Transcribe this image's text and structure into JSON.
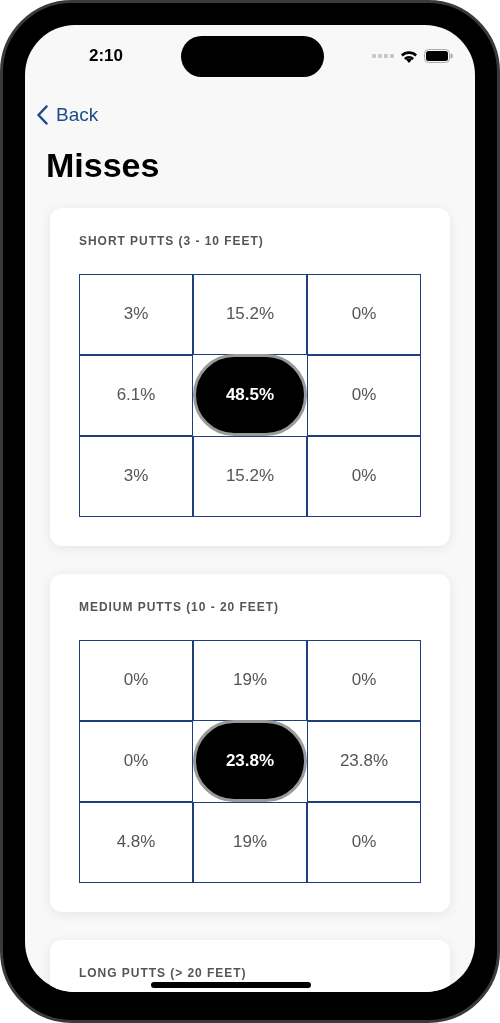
{
  "status_bar": {
    "time": "2:10"
  },
  "back_button": {
    "label": "Back"
  },
  "title": "Misses",
  "sections": [
    {
      "title": "SHORT PUTTS (3 - 10 FEET)",
      "cells": [
        {
          "kind": "zone",
          "value": "3%"
        },
        {
          "kind": "zone",
          "value": "15.2%"
        },
        {
          "kind": "zone",
          "value": "0%"
        },
        {
          "kind": "zone",
          "value": "6.1%"
        },
        {
          "kind": "target",
          "value": "48.5%"
        },
        {
          "kind": "zone",
          "value": "0%"
        },
        {
          "kind": "zone",
          "value": "3%"
        },
        {
          "kind": "zone",
          "value": "15.2%"
        },
        {
          "kind": "zone",
          "value": "0%"
        }
      ]
    },
    {
      "title": "MEDIUM PUTTS (10 - 20 FEET)",
      "cells": [
        {
          "kind": "zone",
          "value": "0%"
        },
        {
          "kind": "zone",
          "value": "19%"
        },
        {
          "kind": "zone",
          "value": "0%"
        },
        {
          "kind": "zone",
          "value": "0%"
        },
        {
          "kind": "target",
          "value": "23.8%"
        },
        {
          "kind": "zone",
          "value": "23.8%"
        },
        {
          "kind": "zone",
          "value": "4.8%"
        },
        {
          "kind": "zone",
          "value": "19%"
        },
        {
          "kind": "zone",
          "value": "0%"
        }
      ]
    },
    {
      "title": "LONG PUTTS (> 20 FEET)"
    }
  ]
}
